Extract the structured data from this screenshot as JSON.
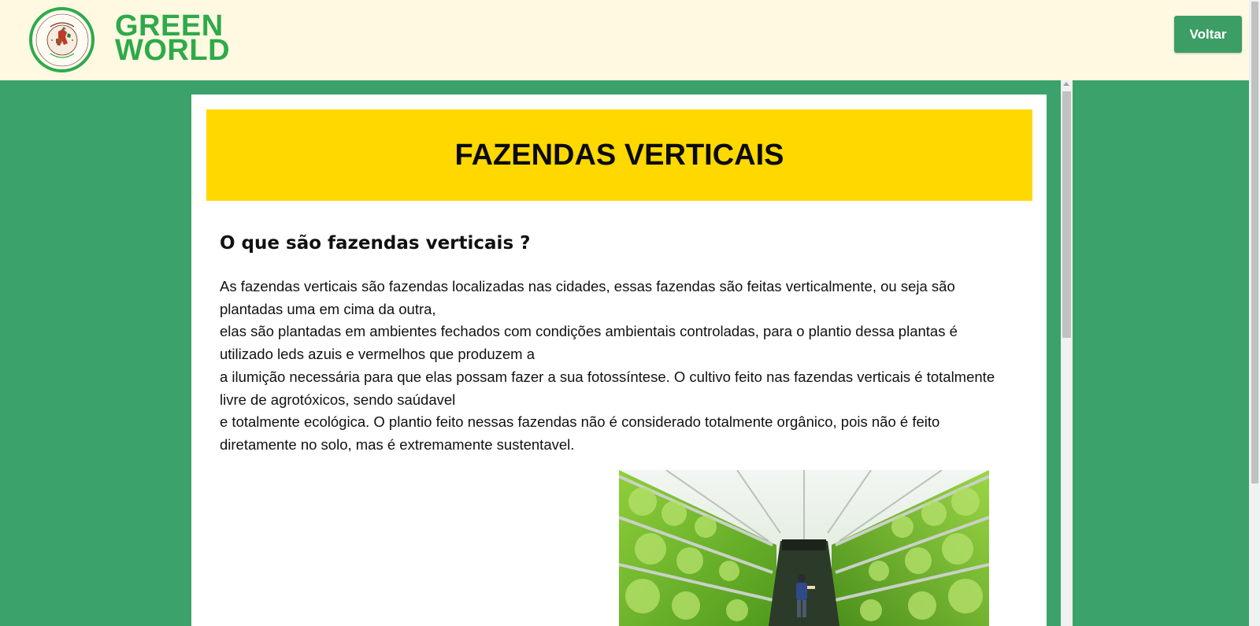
{
  "header": {
    "brand_line1": "GREEN",
    "brand_line2": "WORLD",
    "back_label": "Voltar"
  },
  "article": {
    "title": "FAZENDAS VERTICAIS",
    "subtitle": "O que são fazendas verticais ?",
    "paragraphs": [
      "As fazendas verticais são fazendas localizadas nas cidades, essas fazendas são feitas verticalmente, ou seja são plantadas uma em cima da outra,",
      "elas são plantadas em ambientes fechados com condições ambientais controladas, para o plantio dessa plantas é utilizado leds azuis e vermelhos que produzem a",
      "a ilumição necessária para que elas possam fazer a sua fotossíntese. O cultivo feito nas fazendas verticais é totalmente livre de agrotóxicos, sendo saúdavel",
      "e totalmente ecológica. O plantio feito nessas fazendas não é considerado totalmente orgânico, pois não é feito diretamente no solo, mas é extremamente sustentavel."
    ],
    "image_icon": "vertical-farm-photo"
  },
  "colors": {
    "page_bg": "#3aa26a",
    "header_bg": "#fff9e1",
    "brand": "#2eaa4a",
    "banner": "#ffd800",
    "button": "#3c9e64"
  }
}
